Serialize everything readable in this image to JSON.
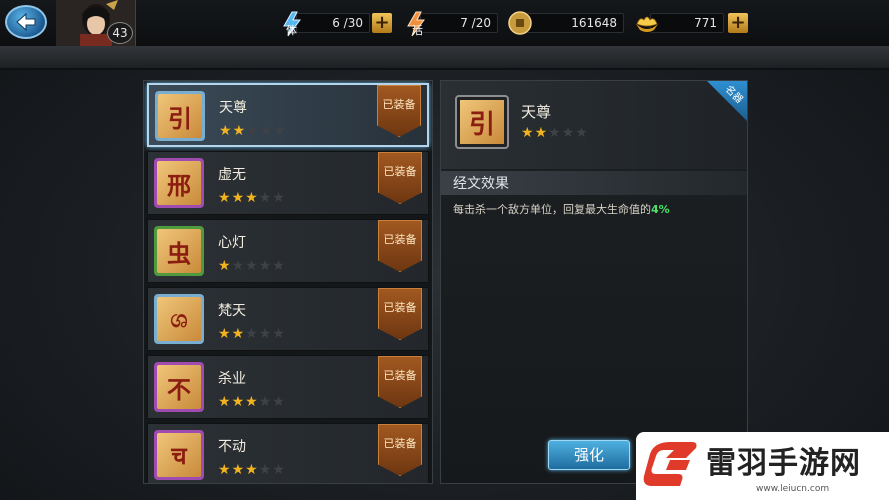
{
  "player": {
    "level": "43"
  },
  "resources": {
    "stamina": {
      "label": "体",
      "value": "6 /30"
    },
    "vitality": {
      "label": "活",
      "value": "7 /20"
    },
    "coins": {
      "value": "161648"
    },
    "ingots": {
      "value": "771"
    }
  },
  "list": {
    "equipped_label": "已装备",
    "items": [
      {
        "name": "天尊",
        "stars": 2,
        "glyph": "引",
        "frame": "#7aaed0"
      },
      {
        "name": "虚无",
        "stars": 3,
        "glyph": "邢",
        "frame": "#a04bb0"
      },
      {
        "name": "心灯",
        "stars": 1,
        "glyph": "虫",
        "frame": "#4f9a3c"
      },
      {
        "name": "梵天",
        "stars": 2,
        "glyph": "ශ",
        "frame": "#7aaed0"
      },
      {
        "name": "杀业",
        "stars": 3,
        "glyph": "不",
        "frame": "#a04bb0"
      },
      {
        "name": "不动",
        "stars": 3,
        "glyph": "च",
        "frame": "#a04bb0"
      }
    ]
  },
  "detail": {
    "badge": "名器",
    "name": "天尊",
    "stars": 2,
    "glyph": "引",
    "section_title": "经文效果",
    "effect_text": "每击杀一个敌方单位，回复最大生命值的",
    "effect_value": "4%"
  },
  "buttons": {
    "enhance": "强化"
  },
  "watermark": {
    "title": "雷羽手游网",
    "url": "www.leiucn.com"
  },
  "colors": {
    "star_on": "#f2b320",
    "star_off": "#3e4145",
    "accent": "#4fb0e0"
  }
}
